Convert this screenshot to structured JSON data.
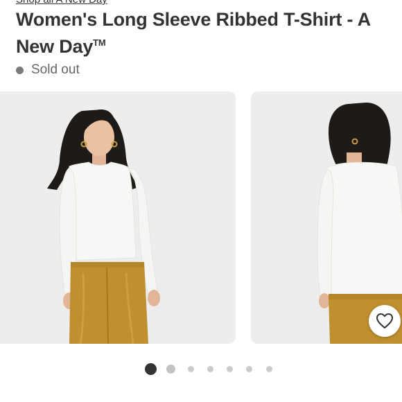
{
  "product": {
    "brand_link": "Shop all A New Day",
    "title": "Women's Long Sleeve Ribbed T-Shirt - A New Day",
    "trademark": "TM",
    "status": "Sold out"
  },
  "carousel": {
    "images": [
      {
        "name": "front view"
      },
      {
        "name": "back view"
      }
    ],
    "active_index": 0,
    "total": 7
  },
  "favorite": {
    "icon": "heart-outline-icon"
  },
  "colors": {
    "title": "#333333",
    "status_dot": "#7a7a7a",
    "active_dot": "#333333",
    "inactive_dot": "#cccccc",
    "shirt": "#f7f7f5",
    "pants": "#c08f2f"
  }
}
